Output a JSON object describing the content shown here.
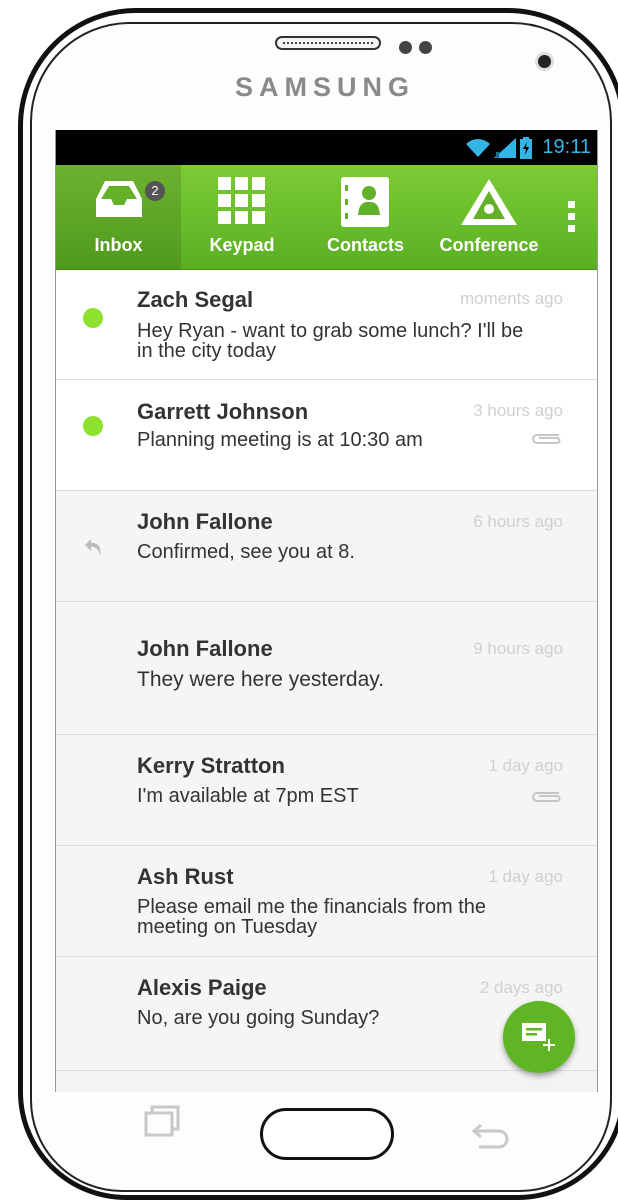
{
  "device": {
    "brand": "SAMSUNG"
  },
  "status_bar": {
    "time": "19:11"
  },
  "tabs": [
    {
      "label": "Inbox",
      "icon": "inbox-icon",
      "badge": "2",
      "active": true
    },
    {
      "label": "Keypad",
      "icon": "keypad-icon"
    },
    {
      "label": "Contacts",
      "icon": "contacts-icon"
    },
    {
      "label": "Conference",
      "icon": "conference-icon"
    }
  ],
  "messages": [
    {
      "sender": "Zach Segal",
      "time": "moments ago",
      "preview_line1": "Hey Ryan - want to grab some lunch? I'll be",
      "preview_line2": "in the city today",
      "unread": true
    },
    {
      "sender": "Garrett Johnson",
      "time": "3 hours ago",
      "preview_line1": "Planning meeting is at 10:30 am",
      "unread": true,
      "attachment": true
    },
    {
      "sender": "John Fallone",
      "time": "6 hours ago",
      "preview_line1": "Confirmed, see you at 8.",
      "replied": true
    },
    {
      "sender": "John Fallone",
      "time": "9 hours ago",
      "preview_line1": "They were here yesterday."
    },
    {
      "sender": "Kerry Stratton",
      "time": "1 day ago",
      "preview_line1": "I'm available at 7pm EST",
      "attachment": true
    },
    {
      "sender": "Ash Rust",
      "time": "1 day ago",
      "preview_line1": "Please email me the financials from the",
      "preview_line2": "meeting on Tuesday"
    },
    {
      "sender": "Alexis Paige",
      "time": "2 days ago",
      "preview_line1": "No, are you going Sunday?"
    }
  ],
  "colors": {
    "accent": "#6cbf2c",
    "unread_dot": "#8fe12f",
    "status_time": "#33b5e5"
  }
}
